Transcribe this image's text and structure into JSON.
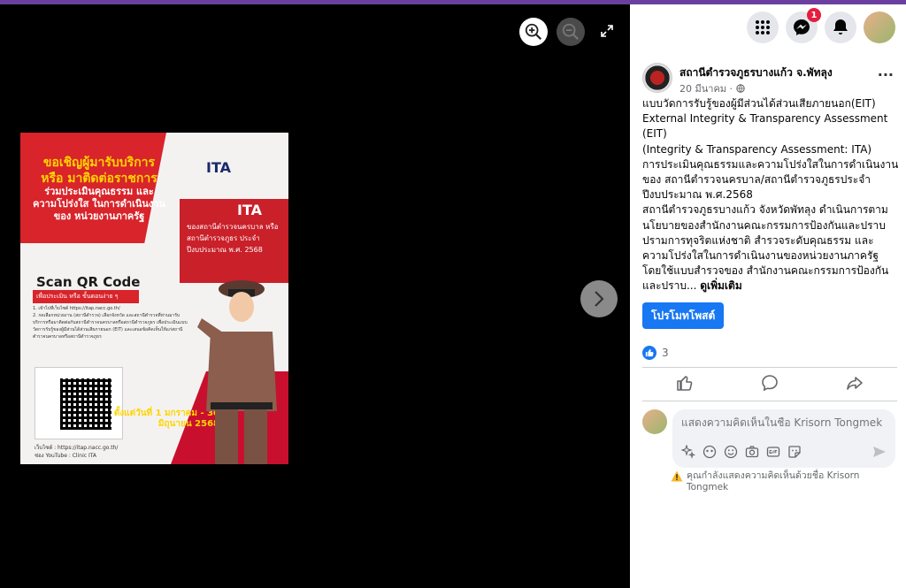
{
  "viewer": {
    "poster": {
      "title": "ขอเชิญผู้มารับบริการ หรือ มาติดต่อราชการ",
      "subtitle": "ร่วมประเมินคุณธรรม และความโปร่งใส ในการดำเนินงานของ หน่วยงานภาครัฐ",
      "logo": "ITA",
      "ita_label": "ITA",
      "ita_sub": "ของสถานีตำรวจนครบาล หรือสถานีตำรวจภูธร ประจำปีงบประมาณ พ.ศ. 2568",
      "qr_title": "Scan QR Code",
      "qr_sub": "เพื่อประเมิน หรือ ขั้นตอนง่าย ๆ",
      "steps": "1. เข้าไปที่เว็บไซต์ https://itap.nacc.go.th/\n2. กดเลือกหน่วยงาน (สถานีตำรวจ) เลือกจังหวัด และสถานีตำรวจที่ท่านมารับบริการหรือมาติดต่อกับสถานีตำรวจนครบาลหรือสถานีตำรวจภูธร เพื่อประเมินแบบวัดการรับรู้ของผู้มีส่วนได้ส่วนเสียภายนอก (EIT) และเสนอข้อคิดเห็นให้แก่สถานีตำรวจนครบาลหรือสถานีตำรวจภูธร",
      "date": "ตั้งแต่วันที่ 1 มกราคม - 30 มิถุนายน 2568",
      "footer_web": "เว็บไซต์ : https://itap.nacc.go.th/",
      "footer_yt": "ช่อง YouTube : Clinic ITA"
    }
  },
  "topbar": {
    "messenger_badge": "1"
  },
  "post": {
    "page_name": "สถานีตำรวจภูธรบางแก้ว จ.พัทลุง",
    "date": "20 มีนาคม ·",
    "text": "แบบวัดการรับรู้ของผู้มีส่วนได้ส่วนเสียภายนอก(EIT)\nExternal Integrity & Transparency Assessment (EIT)\n(Integrity & Transparency Assessment: ITA)\nการประเมินคุณธรรมและความโปร่งใสในการดำเนินงานของ สถานีตำรวจนครบาล/สถานีตำรวจภูธรประจำปีงบประมาณ พ.ศ.2568\nสถานีตำรวจภูธรบางแก้ว จังหวัดพัทลุง ดำเนินการตามนโยบายของสำนักงานคณะกรรมการป้องกันและปราบปรามการทุจริตแห่งชาติ สำรวจระดับคุณธรรม และความโปร่งใสในการดำเนินงานของหน่วยงานภาครัฐ โดยใช้แบบสำรวจของ สำนักงานคณะกรรมการป้องกันและปราบ... ",
    "see_more": "ดูเพิ่มเติม",
    "promote_label": "โปรโมทโพสต์",
    "reaction_count": "3"
  },
  "comment": {
    "placeholder": "แสดงความคิดเห็นในชื่อ Krisorn Tongmek",
    "warning": "คุณกำลังแสดงความคิดเห็นด้วยชื่อ Krisorn Tongmek"
  }
}
